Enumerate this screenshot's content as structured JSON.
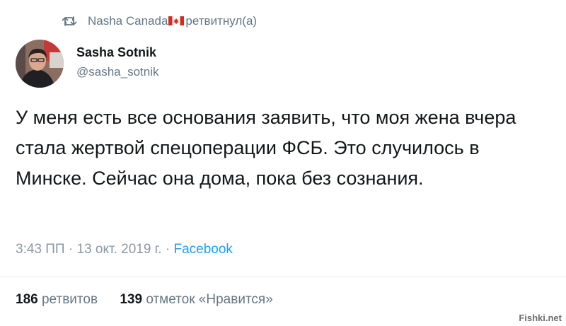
{
  "retweet_header": {
    "icon": "retweet-icon",
    "retweeter_name": "Nasha Canada",
    "flag_icon": "canada-flag-icon",
    "action_text": "ретвитнул(а)"
  },
  "author": {
    "name": "Sasha Sotnik",
    "handle": "@sasha_sotnik",
    "avatar_icon": "avatar"
  },
  "tweet": {
    "text": "У меня есть все основания заявить, что моя жена вчера стала жертвой спецоперации ФСБ. Это случилось в Минске. Сейчас она дома, пока без сознания.",
    "time": "3:43 ПП",
    "separator": " · ",
    "date": "13 окт. 2019 г.",
    "separator2": " · ",
    "source": "Facebook"
  },
  "stats": {
    "retweets_count": "186",
    "retweets_label": "ретвитов",
    "likes_count": "139",
    "likes_label": "отметок «Нравится»"
  },
  "watermark": "Fishki.net",
  "colors": {
    "secondary_text": "#657786",
    "link": "#1da1f2",
    "primary_text": "#14171a"
  }
}
